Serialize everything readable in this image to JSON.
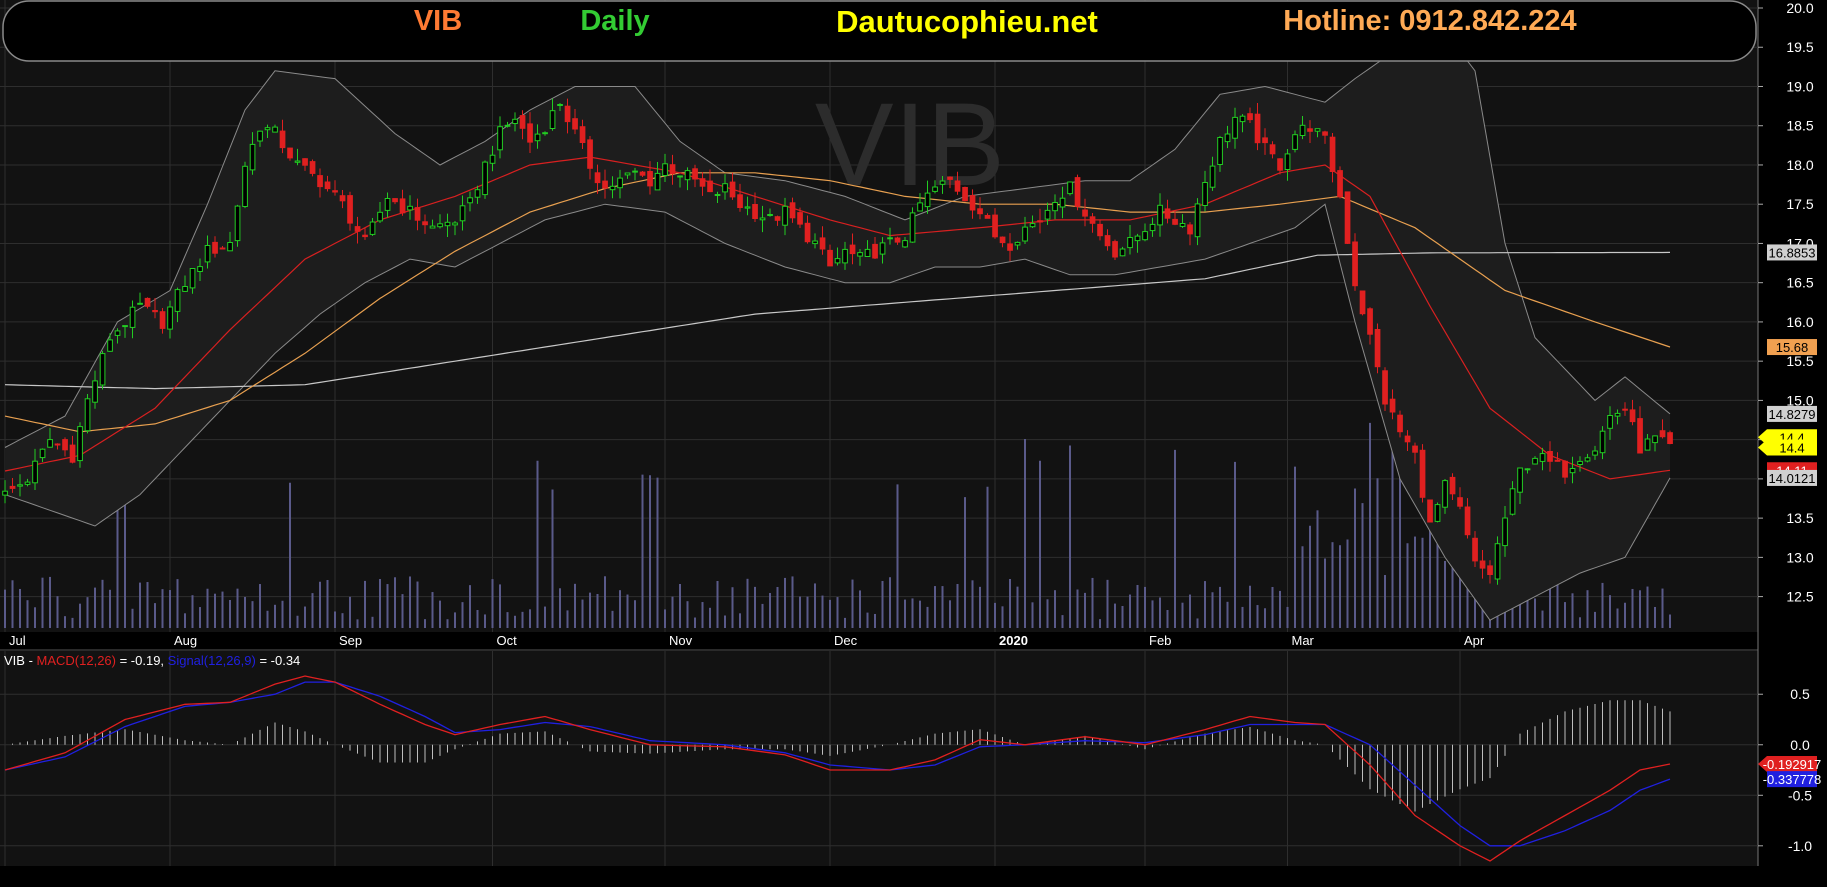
{
  "header": {
    "symbol": "VIB",
    "period": "Daily",
    "site": "Dautucophieu.net",
    "hotline": "Hotline: 0912.842.224",
    "watermark": "VIB"
  },
  "colors": {
    "background": "#000000",
    "panel": "#121212",
    "grid": "#2e2e2e",
    "up": "#22cc22",
    "down": "#e02020",
    "volume": "#5a5a8a",
    "symbol_text": "#ff7a33",
    "period_text": "#33cc33",
    "site_text": "#ffff00",
    "hotline_text": "#ffaa55",
    "ma_red": "#d82020",
    "ma_orange": "#e8a050",
    "ma_long": "#c8c8c8",
    "bollinger": "#8a8a8a",
    "macd": "#e02020",
    "signal": "#2020e0"
  },
  "chart_data": [
    {
      "type": "candlestick",
      "title": "VIB Daily",
      "x_labels": [
        "Jul",
        "Aug",
        "Sep",
        "Oct",
        "Nov",
        "Dec",
        "2020",
        "Feb",
        "Mar",
        "Apr"
      ],
      "x_label_days": [
        0,
        22,
        44,
        65,
        88,
        110,
        132,
        152,
        171,
        194
      ],
      "y_ticks": [
        12.5,
        13.0,
        13.5,
        14.0,
        14.5,
        15.0,
        15.5,
        16.0,
        16.5,
        17.0,
        17.5,
        18.0,
        18.5,
        19.0,
        19.5,
        20.0
      ],
      "y_tick_labels": [
        "12.5",
        "13.0",
        "13.5",
        "14.0",
        "14.5",
        "15.0",
        "15.5",
        "16.0",
        "16.5",
        "17.0",
        "17.5",
        "18.0",
        "18.5",
        "19.0",
        "19.5",
        "20.0"
      ],
      "ylim": [
        12.1,
        20.0
      ],
      "grid": true,
      "price_anchors": [
        [
          0,
          13.8
        ],
        [
          3,
          14.0
        ],
        [
          6,
          14.5
        ],
        [
          9,
          14.3
        ],
        [
          11,
          15.0
        ],
        [
          14,
          15.8
        ],
        [
          18,
          16.2
        ],
        [
          21,
          16.0
        ],
        [
          24,
          16.5
        ],
        [
          27,
          16.9
        ],
        [
          30,
          17.0
        ],
        [
          32,
          18.0
        ],
        [
          34,
          18.5
        ],
        [
          36,
          18.4
        ],
        [
          39,
          18.0
        ],
        [
          42,
          17.8
        ],
        [
          45,
          17.5
        ],
        [
          48,
          17.0
        ],
        [
          51,
          17.6
        ],
        [
          54,
          17.4
        ],
        [
          57,
          17.2
        ],
        [
          60,
          17.3
        ],
        [
          62,
          17.5
        ],
        [
          64,
          18.0
        ],
        [
          66,
          18.4
        ],
        [
          68,
          18.6
        ],
        [
          70,
          18.3
        ],
        [
          72,
          18.5
        ],
        [
          74,
          18.8
        ],
        [
          76,
          18.4
        ],
        [
          78,
          18.0
        ],
        [
          80,
          17.7
        ],
        [
          82,
          17.8
        ],
        [
          84,
          17.9
        ],
        [
          86,
          17.8
        ],
        [
          88,
          18.0
        ],
        [
          90,
          17.9
        ],
        [
          92,
          17.8
        ],
        [
          94,
          17.6
        ],
        [
          96,
          17.7
        ],
        [
          98,
          17.5
        ],
        [
          100,
          17.4
        ],
        [
          102,
          17.3
        ],
        [
          104,
          17.4
        ],
        [
          106,
          17.2
        ],
        [
          108,
          17.0
        ],
        [
          110,
          16.7
        ],
        [
          112,
          16.9
        ],
        [
          114,
          16.8
        ],
        [
          116,
          16.9
        ],
        [
          118,
          17.0
        ],
        [
          120,
          17.1
        ],
        [
          122,
          17.5
        ],
        [
          124,
          17.7
        ],
        [
          126,
          17.8
        ],
        [
          128,
          17.6
        ],
        [
          130,
          17.4
        ],
        [
          132,
          17.1
        ],
        [
          134,
          17.0
        ],
        [
          136,
          17.2
        ],
        [
          138,
          17.3
        ],
        [
          140,
          17.6
        ],
        [
          142,
          17.7
        ],
        [
          144,
          17.4
        ],
        [
          146,
          17.1
        ],
        [
          148,
          16.9
        ],
        [
          150,
          17.0
        ],
        [
          152,
          17.2
        ],
        [
          154,
          17.4
        ],
        [
          156,
          17.3
        ],
        [
          158,
          17.2
        ],
        [
          160,
          17.8
        ],
        [
          162,
          18.3
        ],
        [
          164,
          18.6
        ],
        [
          166,
          18.5
        ],
        [
          168,
          18.2
        ],
        [
          170,
          18.0
        ],
        [
          172,
          18.4
        ],
        [
          174,
          18.5
        ],
        [
          176,
          18.3
        ],
        [
          178,
          17.6
        ],
        [
          180,
          16.5
        ],
        [
          182,
          15.8
        ],
        [
          184,
          15.0
        ],
        [
          186,
          14.6
        ],
        [
          188,
          14.3
        ],
        [
          190,
          13.4
        ],
        [
          192,
          13.9
        ],
        [
          194,
          13.6
        ],
        [
          196,
          12.9
        ],
        [
          198,
          12.8
        ],
        [
          200,
          13.5
        ],
        [
          202,
          14.1
        ],
        [
          204,
          14.3
        ],
        [
          206,
          14.2
        ],
        [
          208,
          14.1
        ],
        [
          210,
          14.3
        ],
        [
          212,
          14.4
        ],
        [
          214,
          14.8
        ],
        [
          216,
          14.9
        ],
        [
          218,
          14.4
        ],
        [
          220,
          14.5
        ],
        [
          222,
          14.4
        ]
      ],
      "ma_red_anchors": [
        [
          0,
          14.1
        ],
        [
          10,
          14.3
        ],
        [
          20,
          14.9
        ],
        [
          30,
          15.9
        ],
        [
          40,
          16.8
        ],
        [
          50,
          17.3
        ],
        [
          60,
          17.6
        ],
        [
          70,
          18.0
        ],
        [
          78,
          18.1
        ],
        [
          90,
          17.9
        ],
        [
          100,
          17.6
        ],
        [
          110,
          17.3
        ],
        [
          118,
          17.1
        ],
        [
          130,
          17.2
        ],
        [
          140,
          17.3
        ],
        [
          150,
          17.3
        ],
        [
          160,
          17.5
        ],
        [
          170,
          17.9
        ],
        [
          176,
          18.0
        ],
        [
          182,
          17.6
        ],
        [
          190,
          16.2
        ],
        [
          198,
          14.9
        ],
        [
          206,
          14.3
        ],
        [
          214,
          14.0
        ],
        [
          222,
          14.11
        ]
      ],
      "ma_orange_anchors": [
        [
          0,
          14.8
        ],
        [
          10,
          14.6
        ],
        [
          20,
          14.7
        ],
        [
          30,
          15.0
        ],
        [
          40,
          15.6
        ],
        [
          50,
          16.3
        ],
        [
          60,
          16.9
        ],
        [
          70,
          17.4
        ],
        [
          80,
          17.7
        ],
        [
          90,
          17.9
        ],
        [
          100,
          17.9
        ],
        [
          110,
          17.8
        ],
        [
          120,
          17.6
        ],
        [
          130,
          17.5
        ],
        [
          140,
          17.5
        ],
        [
          150,
          17.4
        ],
        [
          160,
          17.4
        ],
        [
          170,
          17.5
        ],
        [
          178,
          17.6
        ],
        [
          188,
          17.2
        ],
        [
          200,
          16.4
        ],
        [
          212,
          16.0
        ],
        [
          222,
          15.68
        ]
      ],
      "ma_long_anchors": [
        [
          0,
          15.2
        ],
        [
          20,
          15.15
        ],
        [
          40,
          15.2
        ],
        [
          60,
          15.5
        ],
        [
          80,
          15.8
        ],
        [
          100,
          16.1
        ],
        [
          120,
          16.25
        ],
        [
          140,
          16.4
        ],
        [
          160,
          16.55
        ],
        [
          175,
          16.85
        ],
        [
          190,
          16.88
        ],
        [
          222,
          16.8853
        ]
      ],
      "bb_upper_anchors": [
        [
          0,
          14.4
        ],
        [
          8,
          14.8
        ],
        [
          15,
          16.0
        ],
        [
          22,
          16.4
        ],
        [
          27,
          17.5
        ],
        [
          32,
          18.7
        ],
        [
          36,
          19.2
        ],
        [
          44,
          19.1
        ],
        [
          52,
          18.4
        ],
        [
          58,
          18.0
        ],
        [
          64,
          18.3
        ],
        [
          70,
          18.7
        ],
        [
          76,
          19.0
        ],
        [
          84,
          19.0
        ],
        [
          90,
          18.3
        ],
        [
          96,
          17.9
        ],
        [
          104,
          17.8
        ],
        [
          112,
          17.6
        ],
        [
          120,
          17.3
        ],
        [
          128,
          17.6
        ],
        [
          136,
          17.7
        ],
        [
          144,
          17.8
        ],
        [
          150,
          17.8
        ],
        [
          156,
          18.2
        ],
        [
          162,
          18.9
        ],
        [
          168,
          19.0
        ],
        [
          176,
          18.8
        ],
        [
          180,
          19.1
        ],
        [
          186,
          19.5
        ],
        [
          192,
          19.7
        ],
        [
          196,
          19.2
        ],
        [
          200,
          17.0
        ],
        [
          204,
          15.8
        ],
        [
          212,
          15.0
        ],
        [
          216,
          15.3
        ],
        [
          222,
          14.8279
        ]
      ],
      "bb_lower_anchors": [
        [
          0,
          13.8
        ],
        [
          6,
          13.6
        ],
        [
          12,
          13.4
        ],
        [
          18,
          13.8
        ],
        [
          24,
          14.4
        ],
        [
          30,
          15.0
        ],
        [
          36,
          15.6
        ],
        [
          42,
          16.1
        ],
        [
          48,
          16.5
        ],
        [
          54,
          16.8
        ],
        [
          60,
          16.7
        ],
        [
          66,
          17.0
        ],
        [
          72,
          17.3
        ],
        [
          80,
          17.5
        ],
        [
          88,
          17.4
        ],
        [
          96,
          17.0
        ],
        [
          104,
          16.7
        ],
        [
          112,
          16.5
        ],
        [
          118,
          16.5
        ],
        [
          124,
          16.7
        ],
        [
          130,
          16.7
        ],
        [
          136,
          16.8
        ],
        [
          142,
          16.6
        ],
        [
          148,
          16.6
        ],
        [
          154,
          16.7
        ],
        [
          160,
          16.8
        ],
        [
          166,
          17.0
        ],
        [
          172,
          17.2
        ],
        [
          176,
          17.5
        ],
        [
          180,
          16.0
        ],
        [
          186,
          14.0
        ],
        [
          192,
          13.0
        ],
        [
          198,
          12.2
        ],
        [
          204,
          12.5
        ],
        [
          210,
          12.8
        ],
        [
          216,
          13.0
        ],
        [
          222,
          14.0121
        ]
      ],
      "last_values": {
        "ma_long": "16.8853",
        "ma_orange": "15.68",
        "bb_upper": "14.8279",
        "close_1": "14.4",
        "close_2": "14.4",
        "ma_red": "14.11",
        "bb_lower": "14.0121"
      }
    },
    {
      "type": "line",
      "title": "VIB - MACD(12,26) = -0.19, Signal(12,26,9) = -0.34",
      "legend_prefix": "VIB - ",
      "macd_label": "MACD(12,26)",
      "macd_value_text": " = -0.19, ",
      "signal_label": "Signal(12,26,9)",
      "signal_value_text": " = -0.34",
      "y_ticks": [
        0.5,
        0.0,
        -0.5,
        -1.0
      ],
      "y_tick_labels": [
        "0.5",
        "0.0",
        "-0.5",
        "-1.0"
      ],
      "ylim": [
        -1.18,
        0.72
      ],
      "macd_anchors": [
        [
          0,
          -0.25
        ],
        [
          8,
          -0.08
        ],
        [
          16,
          0.25
        ],
        [
          24,
          0.4
        ],
        [
          30,
          0.42
        ],
        [
          36,
          0.6
        ],
        [
          40,
          0.68
        ],
        [
          44,
          0.62
        ],
        [
          50,
          0.4
        ],
        [
          56,
          0.2
        ],
        [
          60,
          0.1
        ],
        [
          66,
          0.2
        ],
        [
          72,
          0.28
        ],
        [
          78,
          0.15
        ],
        [
          86,
          0.0
        ],
        [
          96,
          -0.02
        ],
        [
          104,
          -0.1
        ],
        [
          110,
          -0.25
        ],
        [
          118,
          -0.25
        ],
        [
          124,
          -0.15
        ],
        [
          130,
          0.05
        ],
        [
          136,
          0.0
        ],
        [
          144,
          0.08
        ],
        [
          152,
          0.0
        ],
        [
          160,
          0.15
        ],
        [
          166,
          0.28
        ],
        [
          172,
          0.22
        ],
        [
          176,
          0.2
        ],
        [
          182,
          -0.2
        ],
        [
          188,
          -0.7
        ],
        [
          194,
          -1.0
        ],
        [
          198,
          -1.15
        ],
        [
          202,
          -0.95
        ],
        [
          208,
          -0.7
        ],
        [
          214,
          -0.45
        ],
        [
          218,
          -0.25
        ],
        [
          222,
          -0.19
        ]
      ],
      "signal_anchors": [
        [
          0,
          -0.25
        ],
        [
          8,
          -0.12
        ],
        [
          16,
          0.18
        ],
        [
          24,
          0.38
        ],
        [
          30,
          0.42
        ],
        [
          36,
          0.5
        ],
        [
          40,
          0.62
        ],
        [
          44,
          0.62
        ],
        [
          50,
          0.48
        ],
        [
          56,
          0.28
        ],
        [
          60,
          0.12
        ],
        [
          66,
          0.15
        ],
        [
          72,
          0.22
        ],
        [
          78,
          0.18
        ],
        [
          86,
          0.04
        ],
        [
          96,
          0.0
        ],
        [
          104,
          -0.08
        ],
        [
          110,
          -0.2
        ],
        [
          118,
          -0.25
        ],
        [
          124,
          -0.2
        ],
        [
          130,
          -0.02
        ],
        [
          136,
          0.0
        ],
        [
          144,
          0.04
        ],
        [
          152,
          0.02
        ],
        [
          160,
          0.1
        ],
        [
          166,
          0.2
        ],
        [
          172,
          0.2
        ],
        [
          176,
          0.2
        ],
        [
          182,
          0.0
        ],
        [
          188,
          -0.4
        ],
        [
          194,
          -0.8
        ],
        [
          198,
          -1.0
        ],
        [
          202,
          -1.0
        ],
        [
          208,
          -0.85
        ],
        [
          214,
          -0.65
        ],
        [
          218,
          -0.45
        ],
        [
          222,
          -0.34
        ]
      ],
      "last_values": {
        "macd": "-0.192917",
        "signal": "-0.337778"
      }
    }
  ]
}
